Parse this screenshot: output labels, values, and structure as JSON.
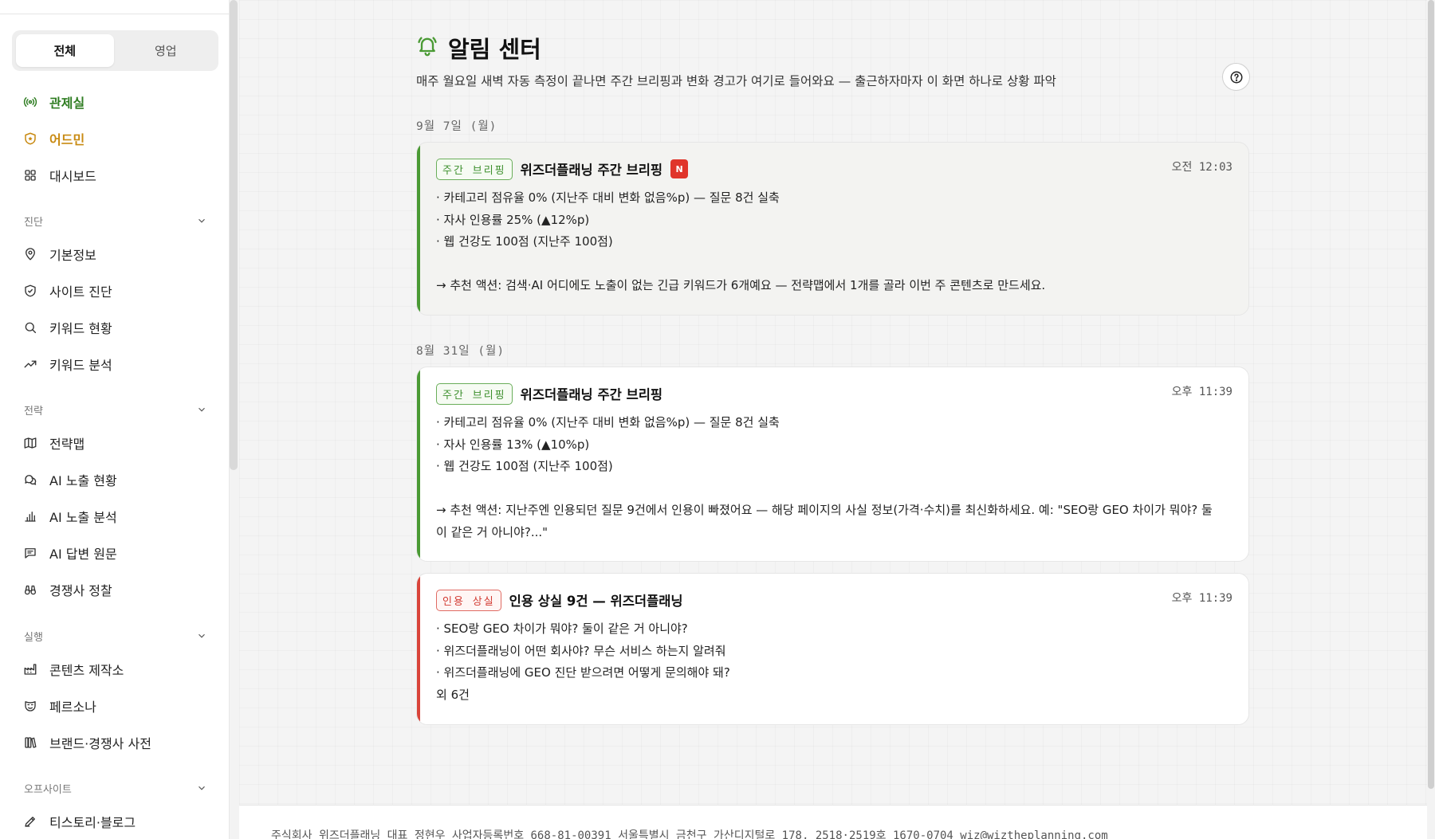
{
  "sidebar": {
    "segments": [
      "전체",
      "영업"
    ],
    "active_segment": "전체",
    "top_items": [
      {
        "label": "관제실",
        "icon": "broadcast-icon"
      },
      {
        "label": "어드민",
        "icon": "shield-star-icon"
      },
      {
        "label": "대시보드",
        "icon": "grid-icon"
      }
    ],
    "sections": [
      {
        "title": "진단",
        "items": [
          {
            "label": "기본정보",
            "icon": "map-pin-icon"
          },
          {
            "label": "사이트 진단",
            "icon": "shield-check-icon"
          },
          {
            "label": "키워드 현황",
            "icon": "search-icon"
          },
          {
            "label": "키워드 분석",
            "icon": "trending-up-icon"
          }
        ]
      },
      {
        "title": "전략",
        "items": [
          {
            "label": "전략맵",
            "icon": "map-icon"
          },
          {
            "label": "AI 노출 현황",
            "icon": "chat-bubbles-icon"
          },
          {
            "label": "AI 노출 분석",
            "icon": "bar-chart-icon"
          },
          {
            "label": "AI 답변 원문",
            "icon": "message-square-icon"
          },
          {
            "label": "경쟁사 정찰",
            "icon": "binoculars-icon"
          }
        ]
      },
      {
        "title": "실행",
        "items": [
          {
            "label": "콘텐츠 제작소",
            "icon": "factory-icon"
          },
          {
            "label": "페르소나",
            "icon": "mask-icon"
          },
          {
            "label": "브랜드·경쟁사 사전",
            "icon": "books-icon"
          }
        ]
      },
      {
        "title": "오프사이트",
        "items": [
          {
            "label": "티스토리·블로그",
            "icon": "pen-icon"
          }
        ]
      }
    ]
  },
  "header": {
    "title": "알림 센터",
    "subtitle": "매주 월요일 새벽 자동 측정이 끝나면 주간 브리핑과 변화 경고가 여기로 들어와요 — 출근하자마자 이 화면 하나로 상황 파악"
  },
  "groups": [
    {
      "date": "9월 7일 (월)",
      "cards": [
        {
          "tag": "주간 브리핑",
          "title": "위즈더플래닝 주간 브리핑",
          "badge": "N",
          "time": "오전 12:03",
          "lines": [
            "· 카테고리 점유율 0% (지난주 대비 변화 없음%p) — 질문 8건 실축",
            "· 자사 인용률 25% (▲12%p)",
            "· 웹 건강도 100점 (지난주 100점)"
          ],
          "action": "→ 추천 액션: 검색·AI 어디에도 노출이 없는 긴급 키워드가 6개예요 — 전략맵에서 1개를 골라 이번 주 콘텐츠로 만드세요."
        }
      ]
    },
    {
      "date": "8월 31일 (월)",
      "cards": [
        {
          "tag": "주간 브리핑",
          "title": "위즈더플래닝 주간 브리핑",
          "time": "오후 11:39",
          "lines": [
            "· 카테고리 점유율 0% (지난주 대비 변화 없음%p) — 질문 8건 실축",
            "· 자사 인용률 13% (▲10%p)",
            "· 웹 건강도 100점 (지난주 100점)"
          ],
          "action_line1": "→ 추천 액션: 지난주엔 인용되던 질문 9건에서 인용이 빠졌어요 — 해당 페이지의 사실 정보(가격·수치)를 최신화하세요. 예: \"SEO랑 GEO 차이가 뭐야? 둘",
          "action_line2": "이 같은 거 아니야?...\""
        },
        {
          "tag": "인용 상실",
          "title": "인용 상실 9건 — 위즈더플래닝",
          "time": "오후 11:39",
          "lines": [
            "· SEO랑 GEO 차이가 뭐야? 둘이 같은 거 아니야?",
            "· 위즈더플래닝이 어떤 회사야? 무슨 서비스 하는지 알려줘",
            "· 위즈더플래닝에 GEO 진단 받으려면 어떻게 문의해야 돼?",
            "외 6건"
          ]
        }
      ]
    }
  ],
  "footer": {
    "text": "주식회사 위즈더플래닝  대표 정현우  사업자등록번호 668-81-00391  서울특별시 금천구 가산디지털로 178, 2518·2519호  1670-0704  wiz@wiztheplanning.com"
  },
  "colors": {
    "accent_green": "#4a9a34",
    "accent_orange": "#c88a12",
    "alert_red": "#d9443a",
    "badge_red": "#e0352b"
  }
}
